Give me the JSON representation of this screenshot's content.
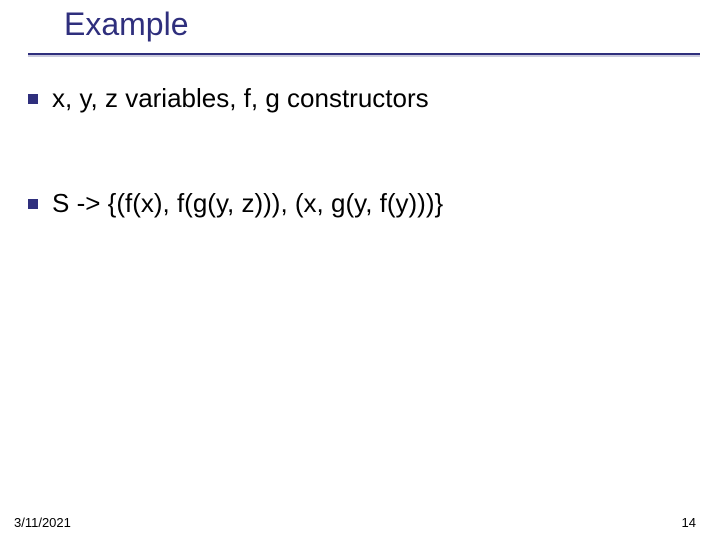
{
  "title": "Example",
  "bullets": [
    "x, y, z variables, f, g constructors",
    "S -> {(f(x), f(g(y, z))), (x, g(y, f(y)))}"
  ],
  "footer": {
    "date": "3/11/2021",
    "page": "14"
  }
}
